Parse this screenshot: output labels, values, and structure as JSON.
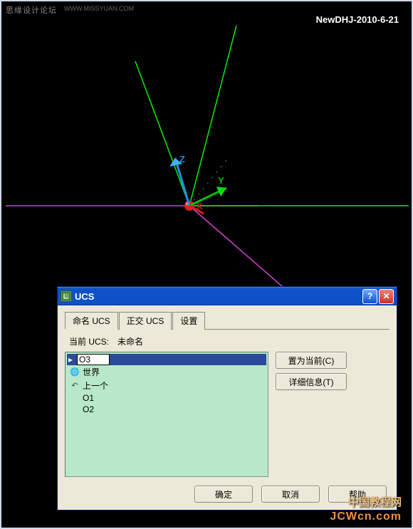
{
  "header": {
    "top_left": "思缘设计论坛",
    "top_left_url": "WWW.MISSYUAN.COM",
    "top_right": "NewDHJ-2010-6-21",
    "bottom_right_1": "中国教程网",
    "bottom_right_2": "JCWcn.com"
  },
  "axes": {
    "x": "X",
    "y": "Y",
    "z": "Z"
  },
  "dialog": {
    "title": "UCS",
    "tabs": {
      "named": "命名 UCS",
      "ortho": "正交 UCS",
      "settings": "设置"
    },
    "current_label": "当前 UCS:　未命名",
    "list": {
      "editing_value": "O3",
      "world": "世界",
      "previous": "上一个",
      "item_o1": "O1",
      "item_o2": "O2"
    },
    "buttons": {
      "set_current": "置为当前(C)",
      "details": "详细信息(T)",
      "ok": "确定",
      "cancel": "取消",
      "help": "帮助"
    }
  }
}
